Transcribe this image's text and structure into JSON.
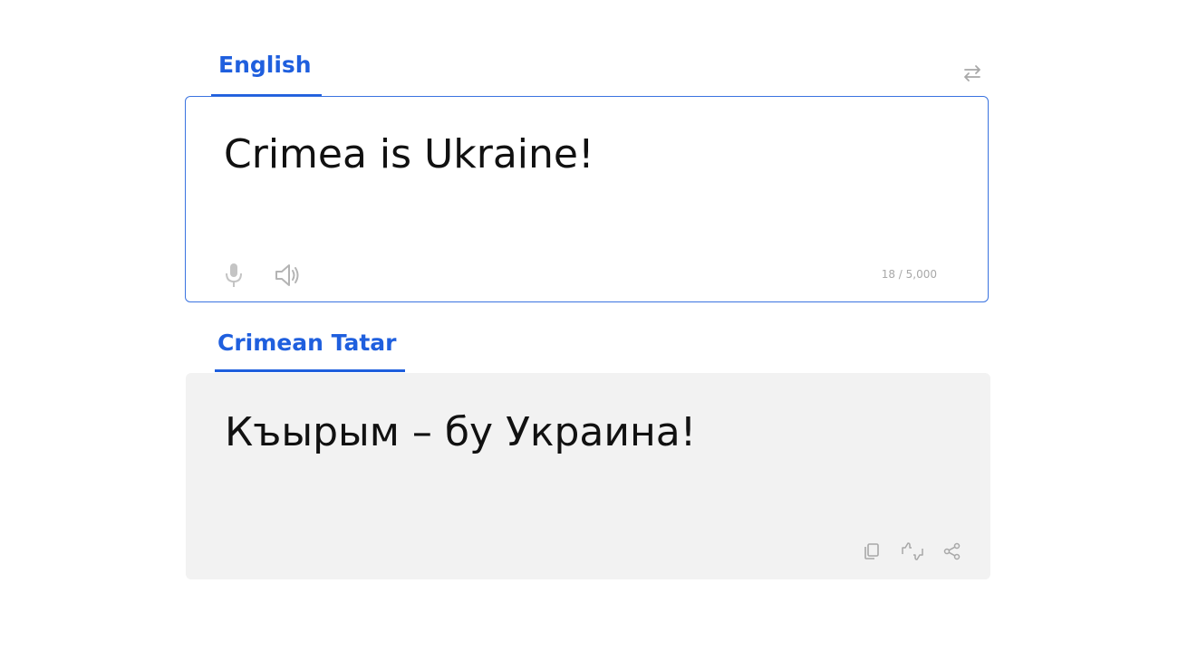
{
  "source": {
    "language": "English",
    "text": "Crimea is Ukraine!",
    "char_count": "18 / 5,000"
  },
  "target": {
    "language": "Crimean Tatar",
    "text": "Къырым – бу Украина!"
  },
  "colors": {
    "accent": "#1f5fde",
    "source_border": "#3a73e0",
    "target_background": "#f2f2f2",
    "icon": "#a8a8a8"
  },
  "icons": {
    "swap": "swap-arrows-icon",
    "mic": "microphone-icon",
    "speaker": "speaker-icon",
    "copy": "copy-icon",
    "feedback": "thumbs-feedback-icon",
    "share": "share-icon"
  }
}
